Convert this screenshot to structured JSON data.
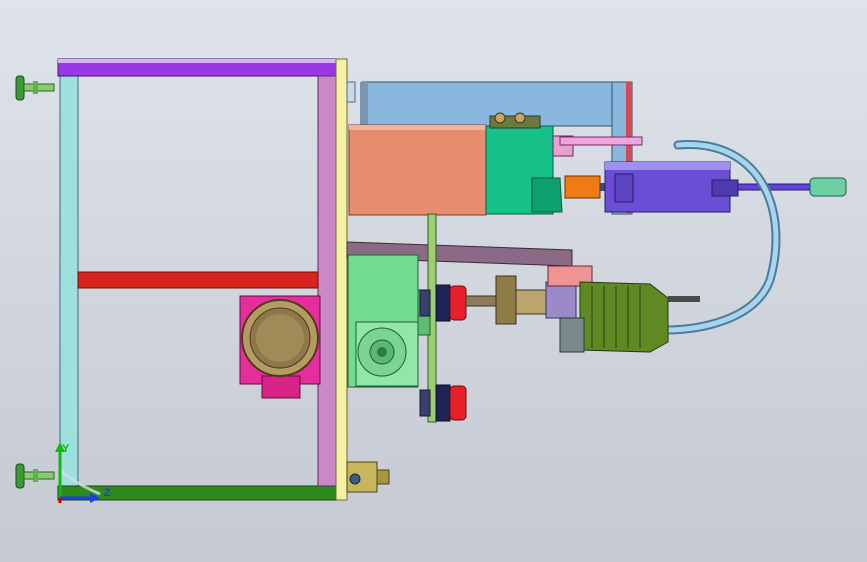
{
  "viewport": {
    "background_top": "#dfe3ea",
    "background_bottom": "#c4c9d2"
  },
  "axis_triad": {
    "labels": {
      "y": "Y",
      "z": "Z"
    },
    "colors": {
      "x": "#d40000",
      "y": "#13b613",
      "z": "#1f3de0"
    }
  },
  "palette": {
    "frame_top": "#9b38e6",
    "frame_bottom": "#2e8a1e",
    "frame_left": "#9ee0de",
    "frame_right": "#c989c6",
    "red_bar": "#d9231f",
    "plate": "#f4f0a4",
    "blue_panel": "#8ab7dd",
    "salmon_box": "#e68c6f",
    "gearbox_green": "#17c18a",
    "cylinder_blue": "#6a4fd6",
    "hose": "#8fc0dc",
    "motor_olive": "#5f8a23",
    "pump_magenta": "#e62d9c",
    "gear_green": "#72dc8e",
    "red_knob": "#e8202a"
  }
}
